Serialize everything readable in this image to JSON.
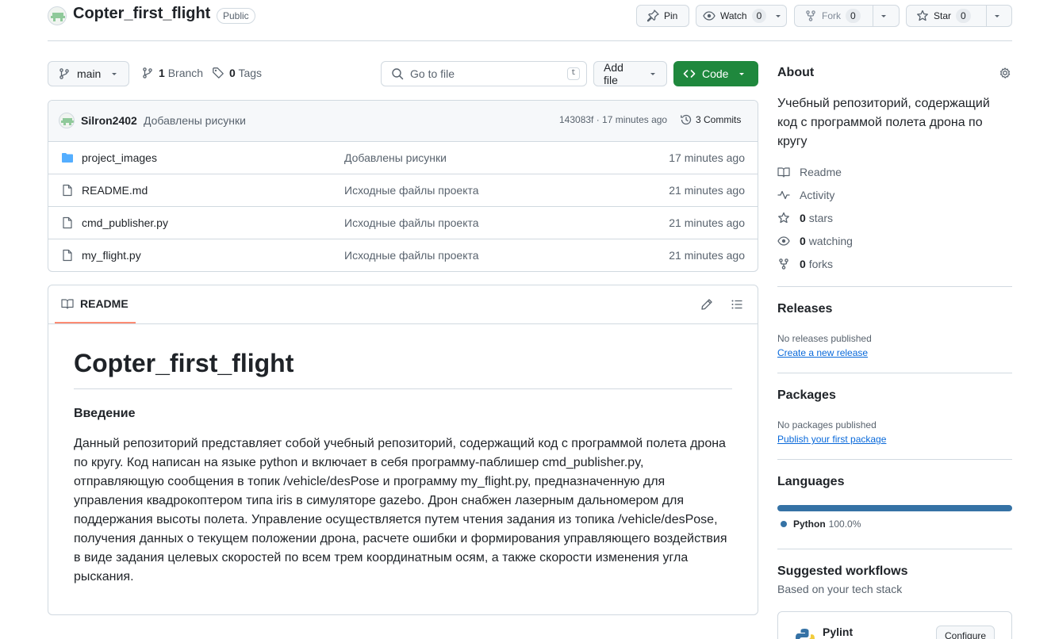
{
  "repo": {
    "name": "Copter_first_flight",
    "visibility": "Public"
  },
  "actions": {
    "pin_label": "Pin",
    "watch_label": "Watch",
    "watch_count": "0",
    "fork_label": "Fork",
    "fork_count": "0",
    "star_label": "Star",
    "star_count": "0"
  },
  "toolbar": {
    "branch": "main",
    "branches_count": "1",
    "branches_label": "Branch",
    "tags_count": "0",
    "tags_label": "Tags",
    "search_placeholder": "Go to file",
    "search_shortcut": "t",
    "add_file_label": "Add file",
    "code_label": "Code"
  },
  "latest_commit": {
    "author": "Silron2402",
    "message": "Добавлены рисунки",
    "meta": "143083f · 17 minutes ago",
    "commits_label": "3 Commits"
  },
  "files": [
    {
      "name": "project_images",
      "type": "folder",
      "message": "Добавлены рисунки",
      "date": "17 minutes ago"
    },
    {
      "name": "README.md",
      "type": "file",
      "message": "Исходные файлы проекта",
      "date": "21 minutes ago"
    },
    {
      "name": "cmd_publisher.py",
      "type": "file",
      "message": "Исходные файлы проекта",
      "date": "21 minutes ago"
    },
    {
      "name": "my_flight.py",
      "type": "file",
      "message": "Исходные файлы проекта",
      "date": "21 minutes ago"
    }
  ],
  "readme": {
    "tab_label": "README",
    "title": "Copter_first_flight",
    "heading": "Введение",
    "paragraph": "Данный репозиторий представляет собой учебный репозиторий, содержащий код с программой полета дрона по кругу. Код написан на языке python и включает в себя программу-паблишер cmd_publisher.py, отправляющую сообщения в топик /vehicle/desPose и программу my_flight.py, предназначенную для управления квадрокоптером типа iris в симуляторе gazebo. Дрон снабжен лазерным дальномером для поддержания высоты полета. Управление осуществляется путем чтения задания из топика /vehicle/desPose, получения данных о текущем положении дрона, расчете ошибки и формирования управляющего воздействия в виде задания целевых скоростей по всем трем координатным осям, а также скорости изменения угла рыскания."
  },
  "about": {
    "title": "About",
    "description": "Учебный репозиторий, содержащий код с программой полета дрона по кругу",
    "readme_label": "Readme",
    "activity_label": "Activity",
    "stars_count": "0",
    "stars_label": "stars",
    "watching_count": "0",
    "watching_label": "watching",
    "forks_count": "0",
    "forks_label": "forks"
  },
  "releases": {
    "title": "Releases",
    "empty_text": "No releases published",
    "create_link": "Create a new release"
  },
  "packages": {
    "title": "Packages",
    "empty_text": "No packages published",
    "publish_link": "Publish your first package"
  },
  "languages": {
    "title": "Languages",
    "items": [
      {
        "name": "Python",
        "percent": "100.0%",
        "fraction": 1.0,
        "color": "#3572A5"
      }
    ]
  },
  "workflows": {
    "title": "Suggested workflows",
    "subtitle": "Based on your tech stack",
    "items": [
      {
        "name": "Pylint",
        "action_label": "Configure"
      }
    ]
  },
  "colors": {
    "accent_green": "#1f883d",
    "link_blue": "#0969da",
    "folder_blue": "#54aeff",
    "tab_underline": "#fd8c73"
  }
}
